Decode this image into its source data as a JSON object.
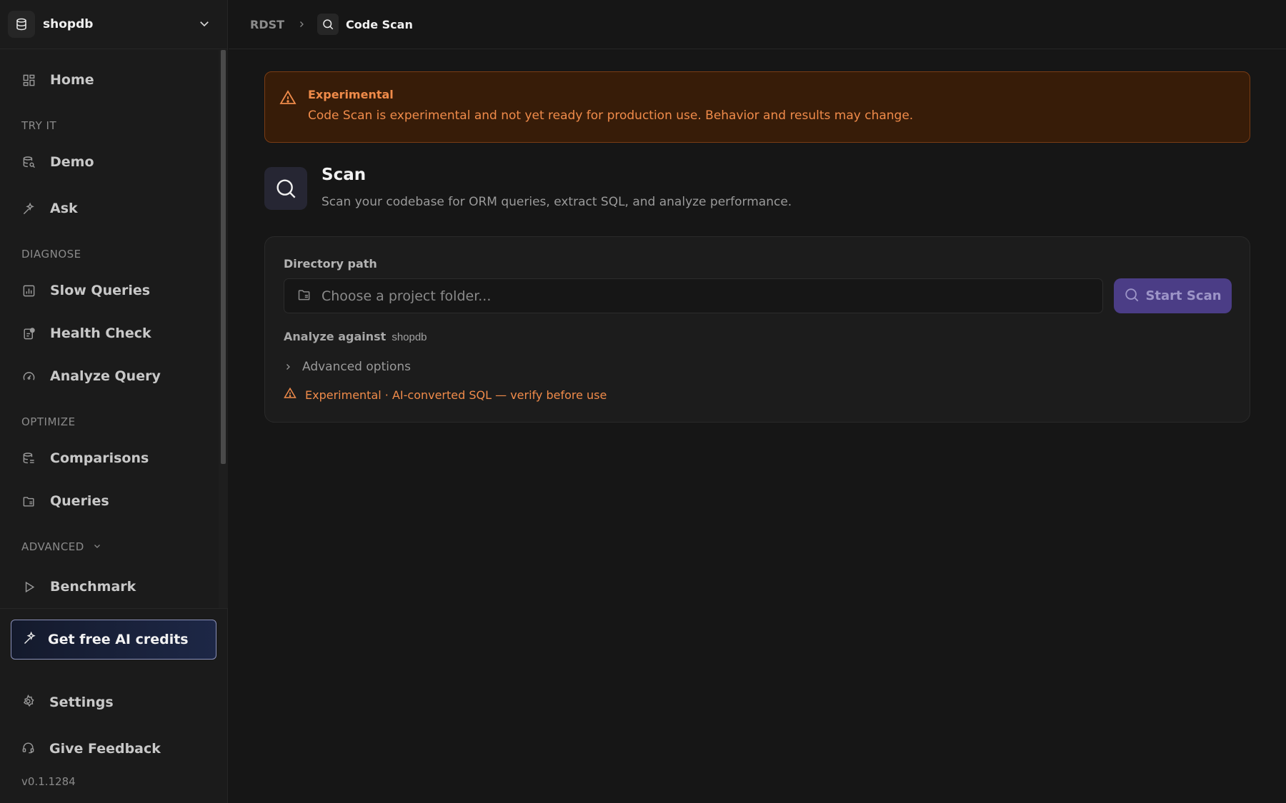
{
  "sidebar": {
    "db_name": "shopdb",
    "items": {
      "home": "Home",
      "demo": "Demo",
      "ask": "Ask",
      "slow_queries": "Slow Queries",
      "health_check": "Health Check",
      "analyze_query": "Analyze Query",
      "comparisons": "Comparisons",
      "queries": "Queries",
      "benchmark": "Benchmark"
    },
    "sections": {
      "try_it": "TRY IT",
      "diagnose": "DIAGNOSE",
      "optimize": "OPTIMIZE",
      "advanced": "ADVANCED"
    },
    "footer": {
      "credits": "Get free AI credits",
      "settings": "Settings",
      "feedback": "Give Feedback",
      "version": "v0.1.1284"
    }
  },
  "breadcrumb": {
    "root": "RDST",
    "current": "Code Scan"
  },
  "banner": {
    "title": "Experimental",
    "text": "Code Scan is experimental and not yet ready for production use. Behavior and results may change."
  },
  "scan": {
    "title": "Scan",
    "subtitle": "Scan your codebase for ORM queries, extract SQL, and analyze performance.",
    "directory_label": "Directory path",
    "directory_value": "",
    "directory_placeholder": "Choose a project folder...",
    "start_button": "Start Scan",
    "analyze_label": "Analyze against",
    "analyze_target": "shopdb",
    "advanced_options": "Advanced options",
    "experimental_note": "Experimental · AI-converted SQL — verify before use"
  },
  "colors": {
    "accent": "#4b3d86",
    "warning": "#f08b4a",
    "banner_bg": "#371c08"
  },
  "icons": {
    "db": "database-icon",
    "home": "grid-icon",
    "demo": "database-search-icon",
    "ask": "sparkle-icon",
    "slow_queries": "bar-chart-icon",
    "health_check": "clipboard-check-icon",
    "analyze_query": "gauge-icon",
    "comparisons": "database-compare-icon",
    "queries": "folder-icon",
    "benchmark": "play-icon",
    "settings": "gear-icon",
    "feedback": "headset-icon",
    "scan": "search-icon",
    "warning": "warning-triangle-icon"
  }
}
